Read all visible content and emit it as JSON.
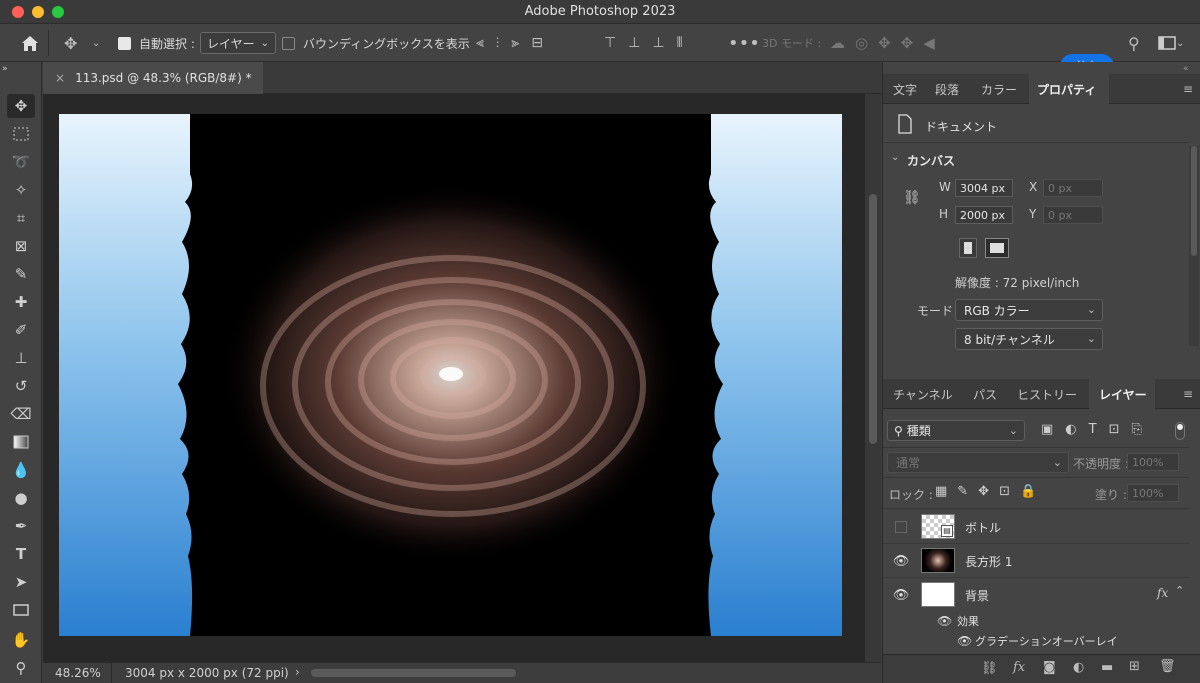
{
  "app": {
    "title": "Adobe Photoshop 2023"
  },
  "options_bar": {
    "auto_select_label": "自動選択 :",
    "auto_select_checked": true,
    "auto_select_value": "レイヤー",
    "bounding_box_label": "バウンディングボックスを表示",
    "bounding_box_checked": false,
    "mode_3d_label": "3D モード :",
    "share_label": "共有"
  },
  "document": {
    "tab_label": "113.psd @ 48.3% (RGB/8#) *",
    "zoom": "48.26%",
    "info": "3004 px x 2000 px (72 ppi)"
  },
  "properties_panel": {
    "tabs": [
      "文字",
      "段落",
      "カラー",
      "プロパティ"
    ],
    "active_tab": "プロパティ",
    "section_document": "ドキュメント",
    "section_canvas": "カンバス",
    "w_label": "W",
    "w_value": "3004 px",
    "h_label": "H",
    "h_value": "2000 px",
    "x_label": "X",
    "x_value": "0 px",
    "y_label": "Y",
    "y_value": "0 px",
    "resolution": "解像度 : 72 pixel/inch",
    "mode_label": "モード",
    "mode_value": "RGB カラー",
    "bit_value": "8 bit/チャンネル"
  },
  "layers_panel": {
    "tabs": [
      "チャンネル",
      "パス",
      "ヒストリー",
      "レイヤー"
    ],
    "active_tab": "レイヤー",
    "filter_value": "種類",
    "blend_mode": "通常",
    "opacity_label": "不透明度 :",
    "opacity_value": "100%",
    "lock_label": "ロック :",
    "fill_label": "塗り :",
    "fill_value": "100%",
    "layers": [
      {
        "name": "ボトル",
        "visible": false
      },
      {
        "name": "長方形 1",
        "visible": true
      },
      {
        "name": "背景",
        "visible": true,
        "fx": "fx"
      }
    ],
    "effects_label": "効果",
    "effect_item": "グラデーションオーバーレイ"
  },
  "colors": {
    "accent": "#1473e6",
    "canvas_gradient_top": "#e6f3fc",
    "canvas_gradient_bottom": "#2a7fd0"
  }
}
